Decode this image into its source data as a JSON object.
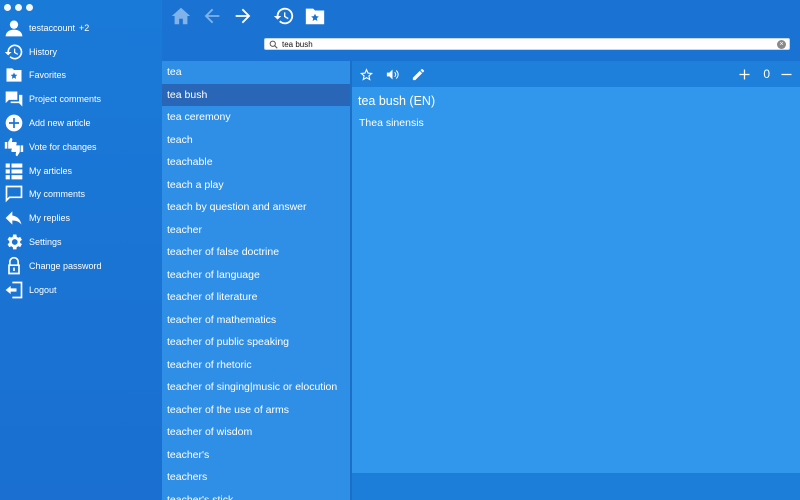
{
  "sidebar": {
    "user": {
      "name": "testaccount",
      "badge": "+2",
      "icon": "user-icon"
    },
    "items": [
      {
        "label": "History",
        "icon": "history-icon"
      },
      {
        "label": "Favorites",
        "icon": "favorites-folder-icon"
      },
      {
        "label": "Project comments",
        "icon": "comments-icon"
      },
      {
        "label": "Add new article",
        "icon": "add-circle-icon"
      },
      {
        "label": "Vote for changes",
        "icon": "thumbs-icon"
      },
      {
        "label": "My articles",
        "icon": "list-icon"
      },
      {
        "label": "My comments",
        "icon": "comment-icon"
      },
      {
        "label": "My replies",
        "icon": "reply-icon"
      },
      {
        "label": "Settings",
        "icon": "gear-icon"
      },
      {
        "label": "Change password",
        "icon": "lock-icon"
      },
      {
        "label": "Logout",
        "icon": "logout-icon"
      }
    ]
  },
  "toolbar": {
    "buttons": [
      "home-icon",
      "back-arrow-icon",
      "forward-arrow-icon",
      "history-icon",
      "favorites-folder-icon"
    ]
  },
  "search": {
    "value": "tea bush",
    "placeholder": ""
  },
  "wordlist": {
    "selected_index": 1,
    "words": [
      "tea",
      "tea bush",
      "tea ceremony",
      "teach",
      "teachable",
      "teach a play",
      "teach by question and answer",
      "teacher",
      "teacher of false doctrine",
      "teacher of language",
      "teacher of literature",
      "teacher of mathematics",
      "teacher of public speaking",
      "teacher of rhetoric",
      "teacher of singing|music or elocution",
      "teacher of the use of arms",
      "teacher of wisdom",
      "teacher's",
      "teachers",
      "teacher's stick"
    ]
  },
  "article": {
    "toolbar": {
      "counter": "0",
      "icons": [
        "star-outline-icon",
        "speaker-icon",
        "pencil-icon",
        "plus-icon",
        "minus-icon"
      ]
    },
    "headword": "tea bush (EN)",
    "definition": "Thea sinensis"
  },
  "colors": {
    "sidebar": "#1a72d3",
    "wordlist": "#2f8fe6",
    "selected": "#2a66b8",
    "article": "#3197ec",
    "toolbar_icon_inactive": "#7fb3ea"
  }
}
